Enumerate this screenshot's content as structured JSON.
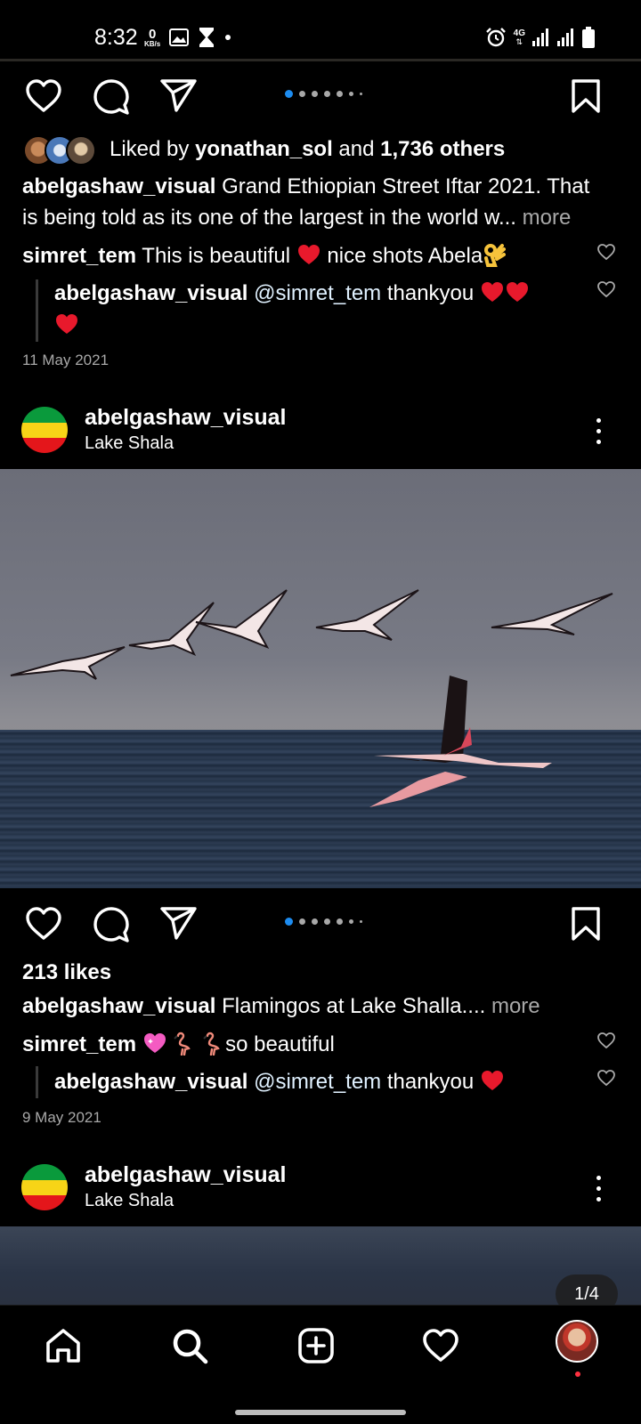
{
  "status_bar": {
    "time": "8:32",
    "speed_value": "0",
    "speed_unit": "KB/s",
    "network": "4G"
  },
  "post1": {
    "liked_by_prefix": "Liked by ",
    "liked_by_user": "yonathan_sol",
    "liked_by_and": " and ",
    "liked_by_others": "1,736 others",
    "caption_user": "abelgashaw_visual",
    "caption_line1": " Grand Ethiopian Street Iftar 2021. That",
    "caption_line2": "is being told as its one of the largest in the world w...",
    "more_label": " more",
    "comment1_user": "simret_tem",
    "comment1_text_a": " This is beautiful ",
    "comment1_text_b": " nice shots Abela",
    "reply_user": "abelgashaw_visual",
    "reply_mention": " @simret_tem",
    "reply_text": " thankyou ",
    "date": "11 May 2021"
  },
  "post2": {
    "username": "abelgashaw_visual",
    "location": "Lake Shala",
    "likes": "213 likes",
    "caption_user": "abelgashaw_visual",
    "caption_text": " Flamingos at Lake Shalla....",
    "more_label": " more",
    "comment1_user": "simret_tem",
    "comment1_text": "so beautiful",
    "reply_user": "abelgashaw_visual",
    "reply_mention": " @simret_tem",
    "reply_text": " thankyou ",
    "date": "9 May 2021"
  },
  "post3": {
    "username": "abelgashaw_visual",
    "location": "Lake Shala",
    "carousel_counter": "1/4"
  },
  "bottom_nav": {
    "items": [
      "home-icon",
      "search-icon",
      "add-post-icon",
      "activity-heart-icon",
      "profile-avatar"
    ]
  },
  "colors": {
    "accent_blue": "#1d8cf0",
    "heart_red": "#ff3040",
    "muted_text": "#a8a8a8"
  }
}
